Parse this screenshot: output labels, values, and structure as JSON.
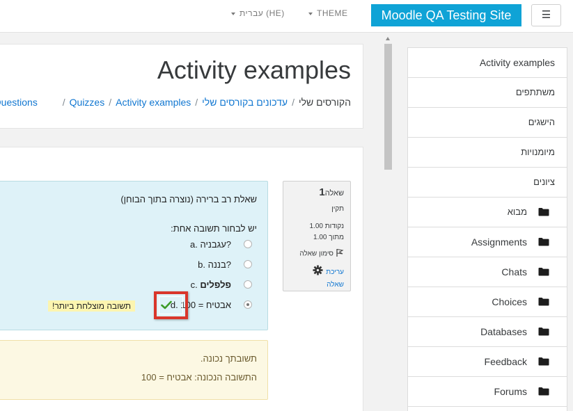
{
  "navbar": {
    "language": "עברית (HE)",
    "theme": "THEME",
    "site_name": "Moodle QA Testing Site",
    "menu_icon": "☰"
  },
  "header": {
    "title": "Activity examples",
    "breadcrumb_cut": "uiz Questions",
    "breadcrumb": [
      {
        "label": "עדכונים בקורסים שלי",
        "link": true
      },
      {
        "label": "הקורסים שלי",
        "link": false
      },
      {
        "label": "Activity examples",
        "link": true
      },
      {
        "label": "Quizzes",
        "link": true
      }
    ]
  },
  "question_info": {
    "label": "שאלה",
    "number": "1",
    "state": "תקין",
    "grade_line1": "1.00 נקודות",
    "grade_line2": "מתוך 1.00",
    "flag_label": "סימון שאלה",
    "edit_line1": "עריכת",
    "edit_line2": "שאלה",
    "icons": {
      "flag": "flag-icon",
      "edit": "gear-icon"
    }
  },
  "question": {
    "text": "שאלת רב ברירה (נוצרה בתוך הבוחן)",
    "prompt": "יש לבחור תשובה אחת:",
    "answers": [
      {
        "letter": "a.",
        "text": "עגבניה?",
        "bold": false,
        "selected": false
      },
      {
        "letter": "b.",
        "text": "בננה?",
        "bold": false,
        "selected": false
      },
      {
        "letter": "c.",
        "text": "פלפלים",
        "bold": true,
        "selected": false
      },
      {
        "letter": "d.",
        "text": "אבטיח = 100",
        "bold": false,
        "selected": true
      }
    ],
    "specific_feedback": "תשובה מוצלחת ביותר!",
    "check_icon": "check-icon"
  },
  "outcome": {
    "correct": "תשובתך נכונה.",
    "right_answer": "התשובה הנכונה: אבטיח = 100"
  },
  "sidebar": {
    "items": [
      {
        "label": "Activity examples",
        "icon": null
      },
      {
        "label": "משתתפים",
        "icon": null
      },
      {
        "label": "הישגים",
        "icon": null
      },
      {
        "label": "מיומנויות",
        "icon": null
      },
      {
        "label": "ציונים",
        "icon": null
      },
      {
        "label": "מבוא",
        "icon": "folder-icon"
      },
      {
        "label": "Assignments",
        "icon": "folder-icon"
      },
      {
        "label": "Chats",
        "icon": "folder-icon"
      },
      {
        "label": "Choices",
        "icon": "folder-icon"
      },
      {
        "label": "Databases",
        "icon": "folder-icon"
      },
      {
        "label": "Feedback",
        "icon": "folder-icon"
      },
      {
        "label": "Forums",
        "icon": "folder-icon"
      }
    ]
  },
  "colors": {
    "brand": "#0fa3d6",
    "link": "#1177d1",
    "question_bg": "#def2f8",
    "outcome_bg": "#fcf8e3",
    "highlight_border": "#d9362b",
    "feedback_highlight": "#fcf5b0"
  }
}
